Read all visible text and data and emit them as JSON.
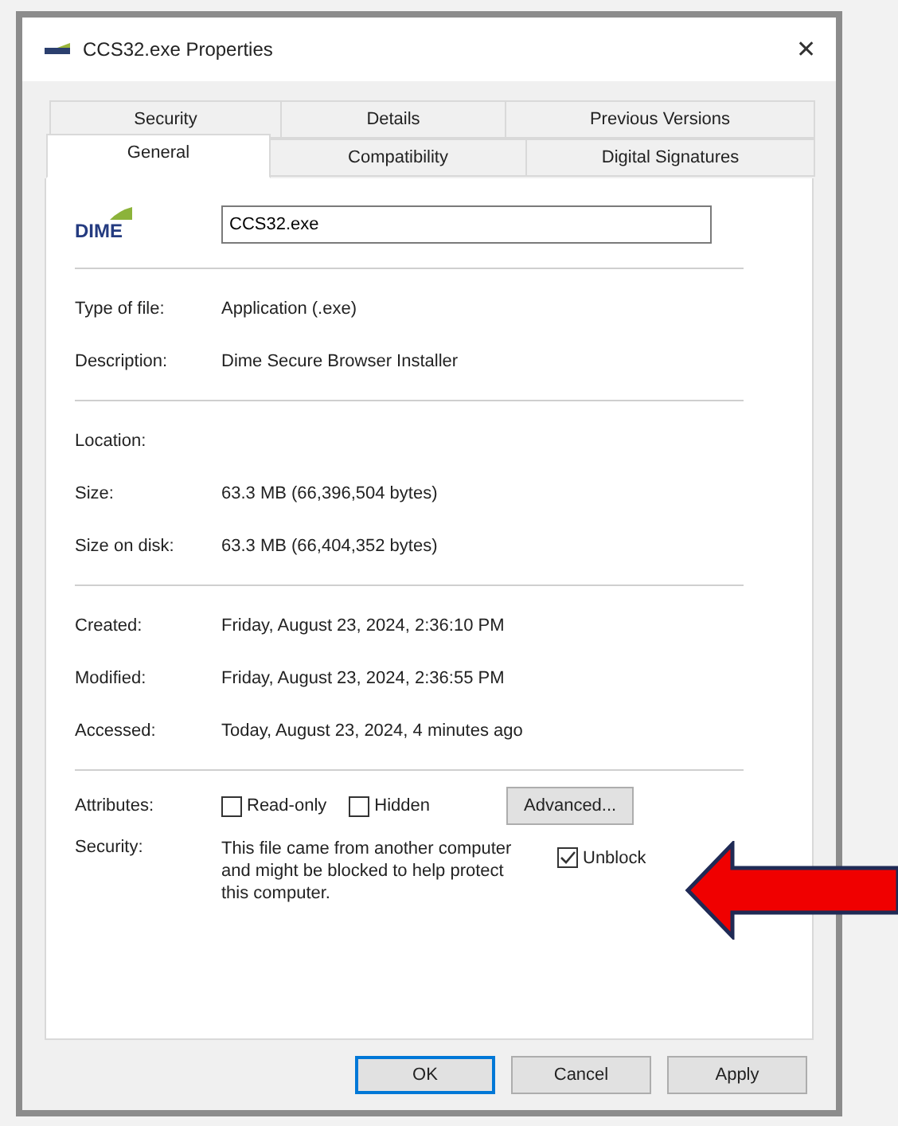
{
  "window": {
    "title": "CCS32.exe Properties",
    "close": "✕"
  },
  "tab_rows": [
    [
      {
        "label": "Security",
        "selected": false
      },
      {
        "label": "Details",
        "selected": false
      },
      {
        "label": "Previous Versions",
        "selected": false
      }
    ],
    [
      {
        "label": "General",
        "selected": true
      },
      {
        "label": "Compatibility",
        "selected": false
      },
      {
        "label": "Digital Signatures",
        "selected": false
      }
    ]
  ],
  "logo": "DIME",
  "file_name": {
    "value": "CCS32.exe"
  },
  "groups": [
    [
      {
        "label": "Type of file:",
        "value": "Application (.exe)"
      },
      {
        "label": "Description:",
        "value": "Dime Secure Browser Installer"
      }
    ],
    [
      {
        "label": "Location:"
      },
      {
        "label": "Size:",
        "value": "63.3 MB (66,396,504 bytes)"
      },
      {
        "label": "Size on disk:",
        "value": "63.3 MB (66,404,352 bytes)"
      }
    ],
    [
      {
        "label": "Created:",
        "value": "Friday, August 23, 2024, 2:36:10 PM"
      },
      {
        "label": "Modified:",
        "value": "Friday, August 23, 2024, 2:36:55 PM"
      },
      {
        "label": "Accessed:",
        "value": "Today, August 23, 2024, 4 minutes ago"
      }
    ]
  ],
  "attributes": {
    "label": "Attributes:",
    "options": [
      {
        "label": "Read-only",
        "checked": false
      },
      {
        "label": "Hidden",
        "checked": false
      }
    ],
    "advanced": "Advanced..."
  },
  "security": {
    "label": "Security:",
    "text": "This file came from another computer and might be blocked to help protect this computer.",
    "unblock": {
      "label": "Unblock",
      "checked": true
    }
  },
  "buttons": [
    {
      "label": "OK",
      "default": true
    },
    {
      "label": "Cancel",
      "default": false
    },
    {
      "label": "Apply",
      "default": false
    }
  ]
}
